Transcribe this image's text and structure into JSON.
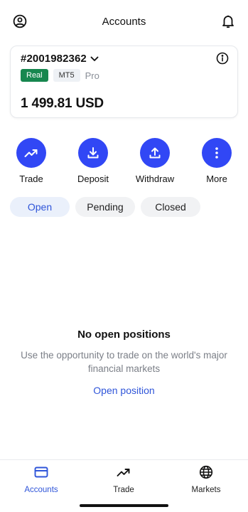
{
  "header": {
    "title": "Accounts",
    "left_icon": "user-circle-icon",
    "right_icon": "bell-icon"
  },
  "account": {
    "id": "#2001982362",
    "type_badge": "Real",
    "platform_badge": "MT5",
    "tier": "Pro",
    "balance": "1 499.81 USD",
    "colors": {
      "real_badge": "#17874f"
    }
  },
  "actions": [
    {
      "label": "Trade",
      "icon": "trend-up-icon"
    },
    {
      "label": "Deposit",
      "icon": "download-icon"
    },
    {
      "label": "Withdraw",
      "icon": "upload-icon"
    },
    {
      "label": "More",
      "icon": "more-vertical-icon"
    }
  ],
  "tabs": [
    {
      "label": "Open",
      "active": true
    },
    {
      "label": "Pending",
      "active": false
    },
    {
      "label": "Closed",
      "active": false
    }
  ],
  "empty_state": {
    "title": "No open positions",
    "description": "Use the opportunity to trade on the world's major financial markets",
    "link": "Open position"
  },
  "bottom_nav": [
    {
      "label": "Accounts",
      "icon": "card-icon",
      "active": true
    },
    {
      "label": "Trade",
      "icon": "trend-up-icon",
      "active": false
    },
    {
      "label": "Markets",
      "icon": "globe-icon",
      "active": false
    }
  ],
  "colors": {
    "accent": "#3147f5",
    "link": "#2f55d9"
  }
}
